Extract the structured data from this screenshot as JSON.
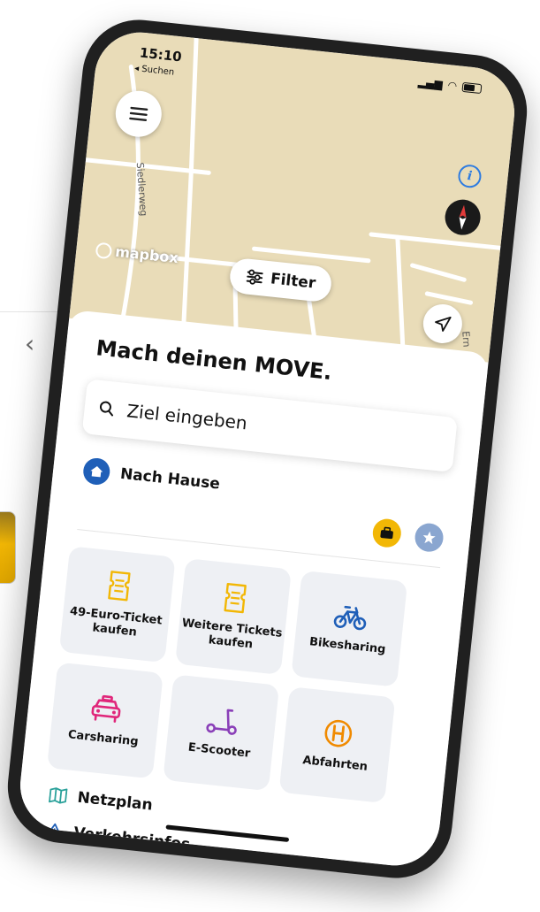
{
  "status_bar": {
    "time": "15:10",
    "back_app": "◂ Suchen"
  },
  "map": {
    "attribution": "mapbox",
    "streets": [
      "Siedlerweg",
      "Ern"
    ],
    "filter_label": "Filter"
  },
  "sheet": {
    "headline": "Mach deinen MOVE.",
    "search_placeholder": "Ziel eingeben",
    "home_label": "Nach Hause"
  },
  "tiles": [
    {
      "label": "49-Euro-Ticket kaufen",
      "icon": "ticket-icon",
      "color": "#f2b705"
    },
    {
      "label": "Weitere Tickets kaufen",
      "icon": "ticket-icon",
      "color": "#f2b705"
    },
    {
      "label": "Bikesharing",
      "icon": "bike-icon",
      "color": "#1f5fb8"
    },
    {
      "label": "Carsharing",
      "icon": "car-icon",
      "color": "#e0267a"
    },
    {
      "label": "E-Scooter",
      "icon": "scooter-icon",
      "color": "#8a3fb8"
    },
    {
      "label": "Abfahrten",
      "icon": "bus-stop-icon",
      "color": "#f08a00"
    }
  ],
  "links": [
    {
      "label": "Netzplan",
      "icon": "map-icon"
    },
    {
      "label": "Verkehrsinfos",
      "icon": "warning-icon"
    }
  ],
  "colors": {
    "primary_blue": "#1f5fb8",
    "accent_yellow": "#f2b705",
    "map_background": "#e9dcb8"
  }
}
